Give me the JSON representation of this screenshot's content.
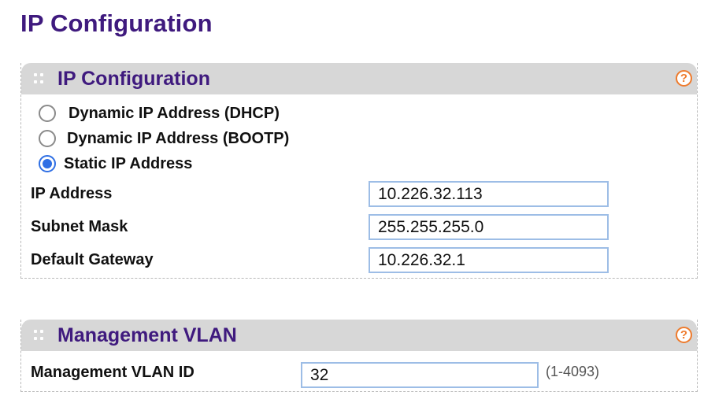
{
  "page": {
    "title": "IP Configuration"
  },
  "ip_panel": {
    "title": "IP Configuration",
    "help_icon": "?",
    "modes": [
      {
        "label": "Dynamic IP Address (DHCP)",
        "selected": false
      },
      {
        "label": "Dynamic IP Address (BOOTP)",
        "selected": false
      },
      {
        "label": "Static IP Address",
        "selected": true
      }
    ],
    "ip_address": {
      "label": "IP Address",
      "value": "10.226.32.113"
    },
    "subnet_mask": {
      "label": "Subnet Mask",
      "value": "255.255.255.0"
    },
    "default_gateway": {
      "label": "Default Gateway",
      "value": "10.226.32.1"
    }
  },
  "vlan_panel": {
    "title": "Management VLAN",
    "help_icon": "?",
    "vlan_id": {
      "label": "Management VLAN ID",
      "value": "32",
      "range_hint": "(1-4093)"
    }
  },
  "colors": {
    "title_purple": "#3f1a7e",
    "header_gray": "#d7d7d7",
    "help_orange": "#ee7b2d",
    "radio_blue": "#2f6fe4",
    "input_border": "#9dbde6"
  }
}
